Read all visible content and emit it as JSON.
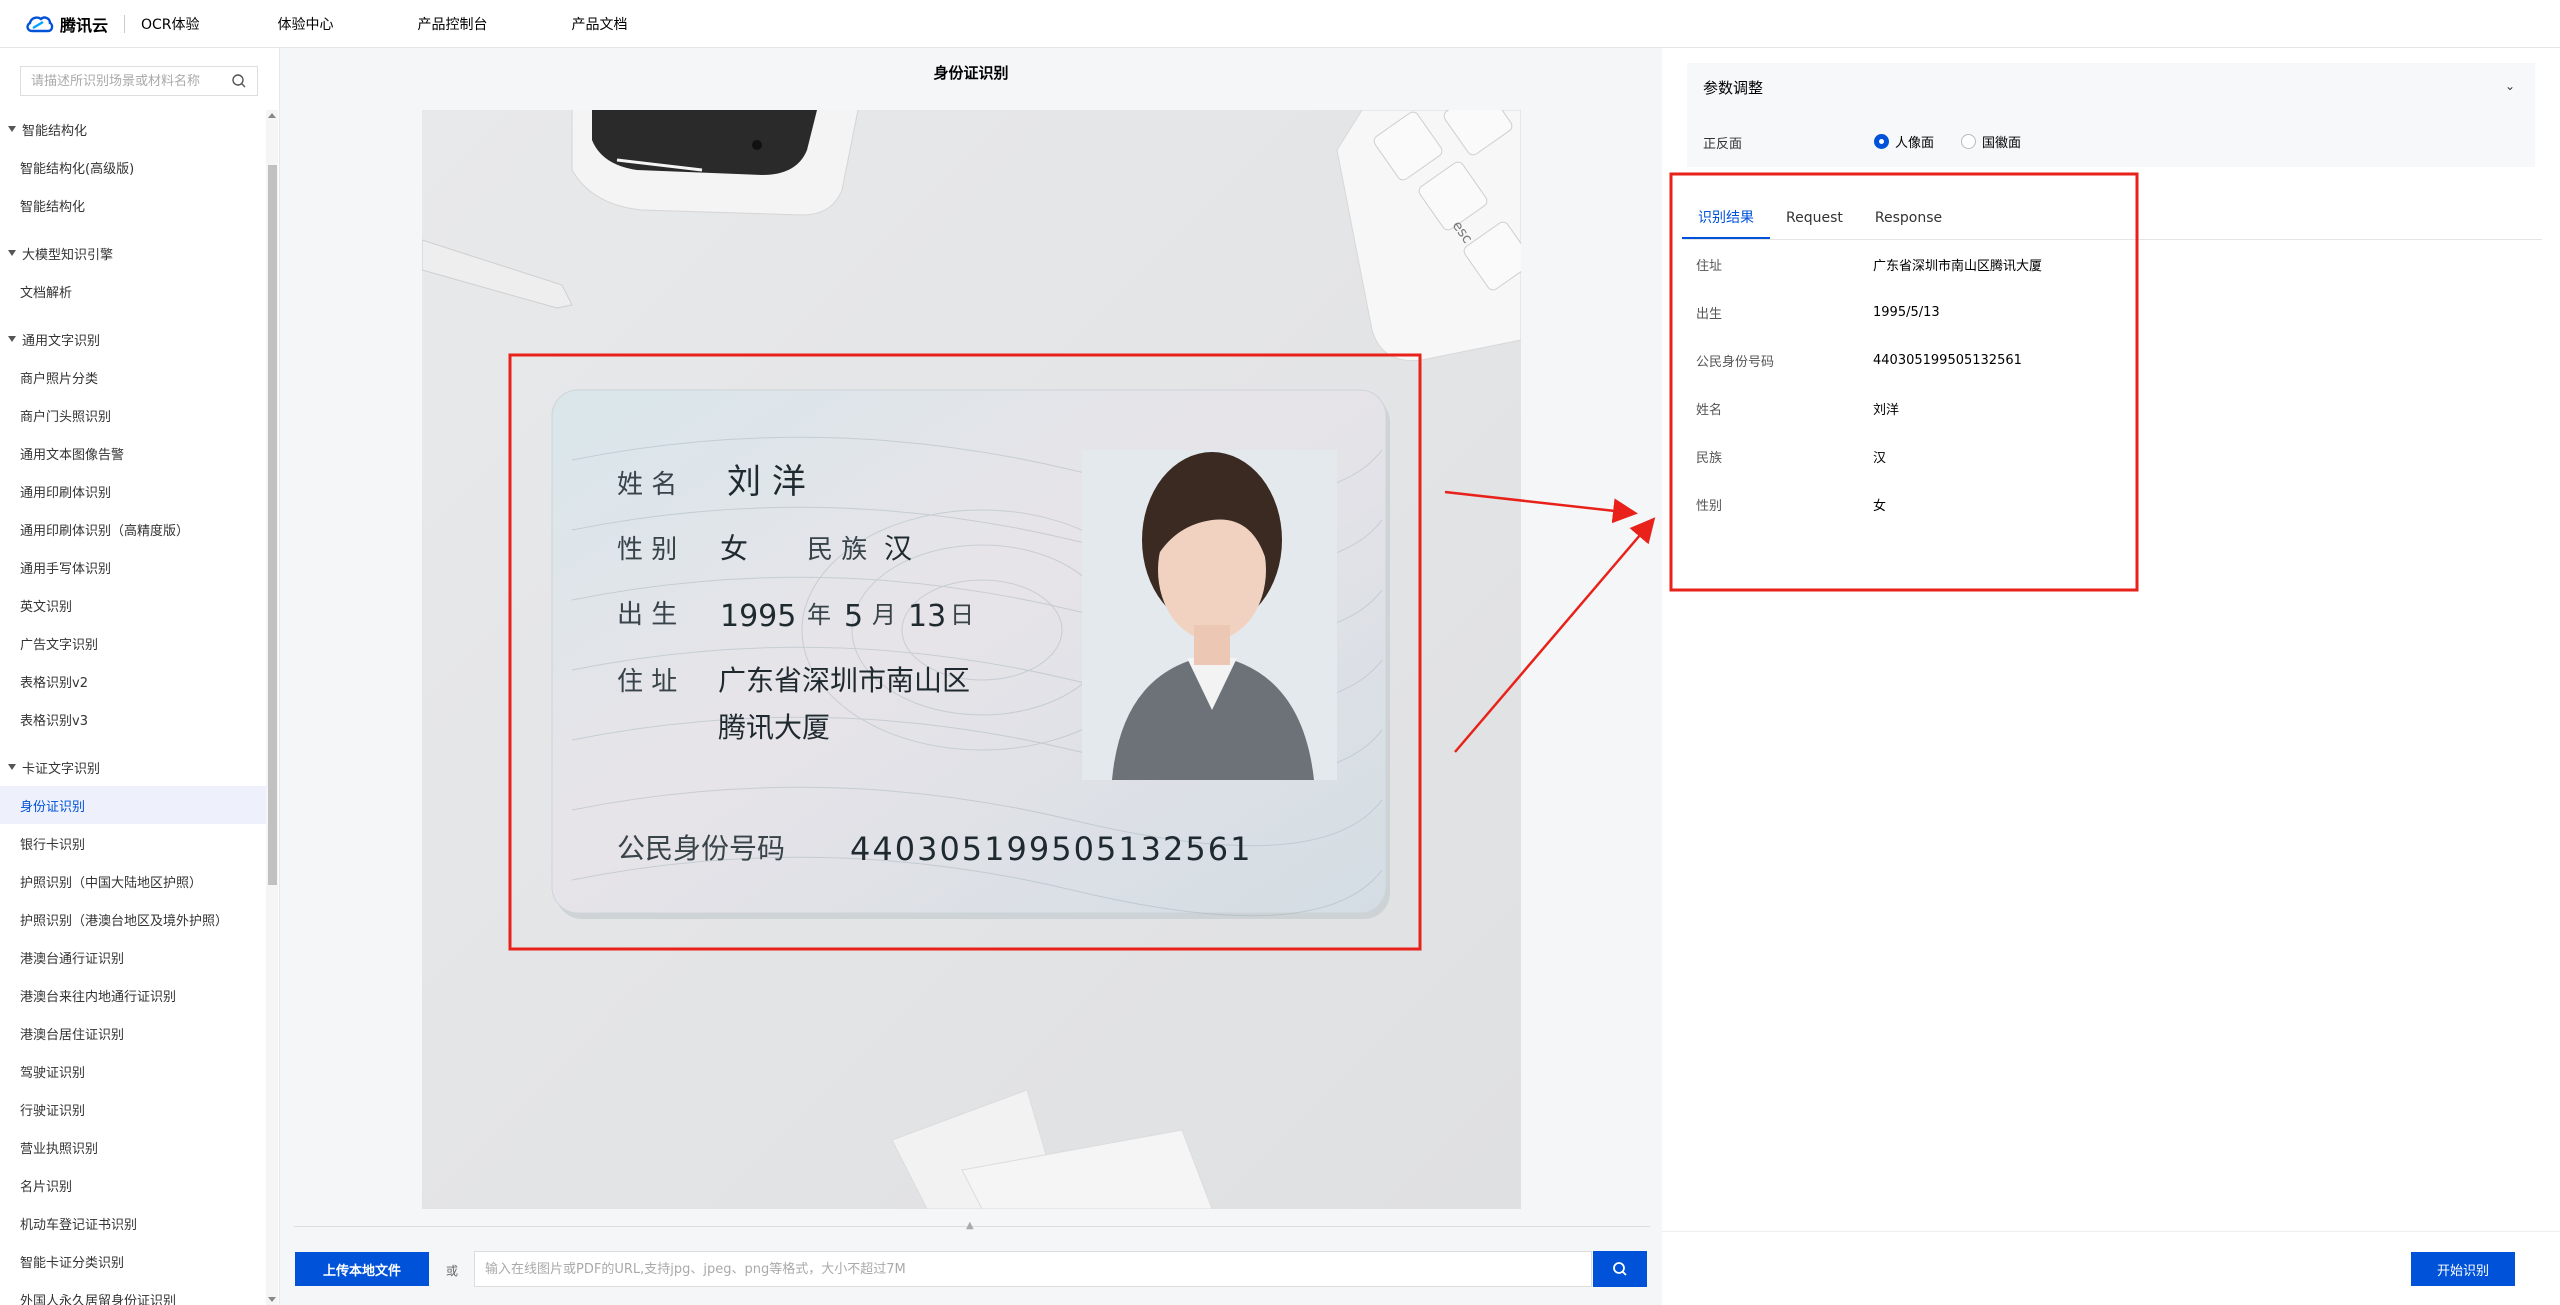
{
  "topnav": {
    "brand_name": "腾讯云",
    "brand_sub": "OCR体验",
    "items": [
      "体验中心",
      "产品控制台",
      "产品文档"
    ]
  },
  "sidebar": {
    "search_placeholder": "请描述所识别场景或材料名称",
    "groups": [
      {
        "title": "智能结构化",
        "items": [
          "智能结构化(高级版)",
          "智能结构化"
        ]
      },
      {
        "title": "大模型知识引擎",
        "items": [
          "文档解析"
        ]
      },
      {
        "title": "通用文字识别",
        "items": [
          "商户照片分类",
          "商户门头照识别",
          "通用文本图像告警",
          "通用印刷体识别",
          "通用印刷体识别（高精度版）",
          "通用手写体识别",
          "英文识别",
          "广告文字识别",
          "表格识别v2",
          "表格识别v3"
        ]
      },
      {
        "title": "卡证文字识别",
        "items": [
          "身份证识别",
          "银行卡识别",
          "护照识别（中国大陆地区护照）",
          "护照识别（港澳台地区及境外护照）",
          "港澳台通行证识别",
          "港澳台来往内地通行证识别",
          "港澳台居住证识别",
          "驾驶证识别",
          "行驶证识别",
          "营业执照识别",
          "名片识别",
          "机动车登记证书识别",
          "智能卡证分类识别",
          "外国人永久居留身份证识别"
        ]
      }
    ],
    "active_item": "身份证识别"
  },
  "center": {
    "title": "身份证识别",
    "upload_label": "上传本地文件",
    "or_text": "或",
    "url_placeholder": "输入在线图片或PDF的URL,支持jpg、jpeg、png等格式，大小不超过7M"
  },
  "id_card": {
    "name_label": "姓 名",
    "name": "刘 洋",
    "sex_label": "性 别",
    "sex": "女",
    "ethnic_label": "民 族",
    "ethnic": "汉",
    "birth_label": "出 生",
    "birth_year": "1995",
    "birth_year_unit": "年",
    "birth_month": "5",
    "birth_month_unit": "月",
    "birth_day": "13",
    "birth_day_unit": "日",
    "address_label": "住 址",
    "address_line1": "广东省深圳市南山区",
    "address_line2": "腾讯大厦",
    "id_label": "公民身份号码",
    "id_number": "440305199505132561"
  },
  "right": {
    "params_title": "参数调整",
    "side_label": "正反面",
    "radio_front": "人像面",
    "radio_back": "国徽面",
    "tabs": [
      "识别结果",
      "Request",
      "Response"
    ],
    "results": [
      {
        "key": "住址",
        "value": "广东省深圳市南山区腾讯大厦"
      },
      {
        "key": "出生",
        "value": "1995/5/13"
      },
      {
        "key": "公民身份号码",
        "value": "440305199505132561"
      },
      {
        "key": "姓名",
        "value": "刘洋"
      },
      {
        "key": "民族",
        "value": "汉"
      },
      {
        "key": "性别",
        "value": "女"
      }
    ],
    "start_button": "开始识别"
  },
  "colors": {
    "accent": "#0052d9",
    "annotation_red": "#e8221a"
  }
}
